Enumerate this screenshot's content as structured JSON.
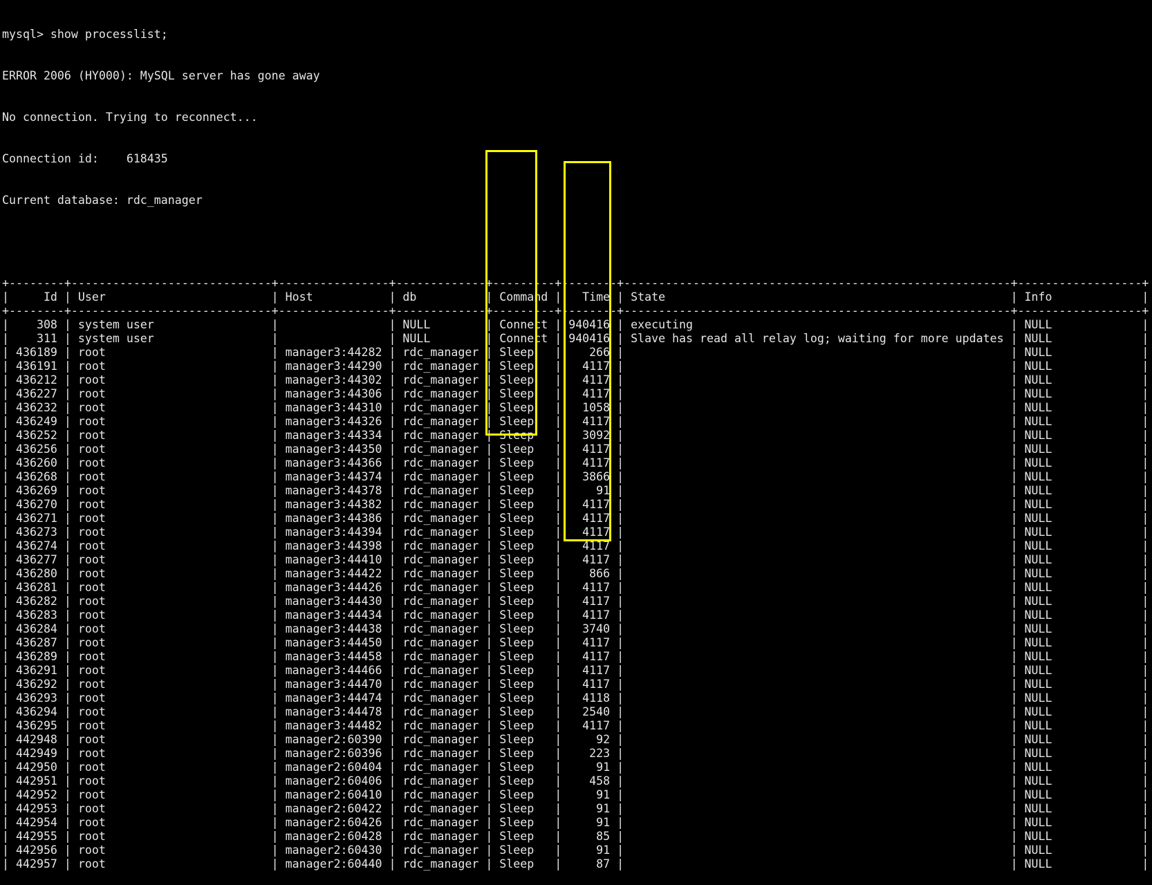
{
  "terminal": {
    "prompt_line": "mysql> show processlist;",
    "messages": [
      "ERROR 2006 (HY000): MySQL server has gone away",
      "No connection. Trying to reconnect...",
      "Connection id:    618435",
      "Current database: rdc_manager"
    ]
  },
  "table": {
    "columns": [
      "Id",
      "User",
      "Host",
      "db",
      "Command",
      "Time",
      "State",
      "Info"
    ],
    "rows": [
      [
        "308",
        "system user",
        "",
        "NULL",
        "Connect",
        "940416",
        "executing",
        "NULL"
      ],
      [
        "311",
        "system user",
        "",
        "NULL",
        "Connect",
        "940416",
        "Slave has read all relay log; waiting for more updates",
        "NULL"
      ],
      [
        "436189",
        "root",
        "manager3:44282",
        "rdc_manager",
        "Sleep",
        "266",
        "",
        "NULL"
      ],
      [
        "436191",
        "root",
        "manager3:44290",
        "rdc_manager",
        "Sleep",
        "4117",
        "",
        "NULL"
      ],
      [
        "436212",
        "root",
        "manager3:44302",
        "rdc_manager",
        "Sleep",
        "4117",
        "",
        "NULL"
      ],
      [
        "436227",
        "root",
        "manager3:44306",
        "rdc_manager",
        "Sleep",
        "4117",
        "",
        "NULL"
      ],
      [
        "436232",
        "root",
        "manager3:44310",
        "rdc_manager",
        "Sleep",
        "1058",
        "",
        "NULL"
      ],
      [
        "436249",
        "root",
        "manager3:44326",
        "rdc_manager",
        "Sleep",
        "4117",
        "",
        "NULL"
      ],
      [
        "436252",
        "root",
        "manager3:44334",
        "rdc_manager",
        "Sleep",
        "3092",
        "",
        "NULL"
      ],
      [
        "436256",
        "root",
        "manager3:44350",
        "rdc_manager",
        "Sleep",
        "4117",
        "",
        "NULL"
      ],
      [
        "436260",
        "root",
        "manager3:44366",
        "rdc_manager",
        "Sleep",
        "4117",
        "",
        "NULL"
      ],
      [
        "436268",
        "root",
        "manager3:44374",
        "rdc_manager",
        "Sleep",
        "3866",
        "",
        "NULL"
      ],
      [
        "436269",
        "root",
        "manager3:44378",
        "rdc_manager",
        "Sleep",
        "91",
        "",
        "NULL"
      ],
      [
        "436270",
        "root",
        "manager3:44382",
        "rdc_manager",
        "Sleep",
        "4117",
        "",
        "NULL"
      ],
      [
        "436271",
        "root",
        "manager3:44386",
        "rdc_manager",
        "Sleep",
        "4117",
        "",
        "NULL"
      ],
      [
        "436273",
        "root",
        "manager3:44394",
        "rdc_manager",
        "Sleep",
        "4117",
        "",
        "NULL"
      ],
      [
        "436274",
        "root",
        "manager3:44398",
        "rdc_manager",
        "Sleep",
        "4117",
        "",
        "NULL"
      ],
      [
        "436277",
        "root",
        "manager3:44410",
        "rdc_manager",
        "Sleep",
        "4117",
        "",
        "NULL"
      ],
      [
        "436280",
        "root",
        "manager3:44422",
        "rdc_manager",
        "Sleep",
        "866",
        "",
        "NULL"
      ],
      [
        "436281",
        "root",
        "manager3:44426",
        "rdc_manager",
        "Sleep",
        "4117",
        "",
        "NULL"
      ],
      [
        "436282",
        "root",
        "manager3:44430",
        "rdc_manager",
        "Sleep",
        "4117",
        "",
        "NULL"
      ],
      [
        "436283",
        "root",
        "manager3:44434",
        "rdc_manager",
        "Sleep",
        "4117",
        "",
        "NULL"
      ],
      [
        "436284",
        "root",
        "manager3:44438",
        "rdc_manager",
        "Sleep",
        "3740",
        "",
        "NULL"
      ],
      [
        "436287",
        "root",
        "manager3:44450",
        "rdc_manager",
        "Sleep",
        "4117",
        "",
        "NULL"
      ],
      [
        "436289",
        "root",
        "manager3:44458",
        "rdc_manager",
        "Sleep",
        "4117",
        "",
        "NULL"
      ],
      [
        "436291",
        "root",
        "manager3:44466",
        "rdc_manager",
        "Sleep",
        "4117",
        "",
        "NULL"
      ],
      [
        "436292",
        "root",
        "manager3:44470",
        "rdc_manager",
        "Sleep",
        "4117",
        "",
        "NULL"
      ],
      [
        "436293",
        "root",
        "manager3:44474",
        "rdc_manager",
        "Sleep",
        "4118",
        "",
        "NULL"
      ],
      [
        "436294",
        "root",
        "manager3:44478",
        "rdc_manager",
        "Sleep",
        "2540",
        "",
        "NULL"
      ],
      [
        "436295",
        "root",
        "manager3:44482",
        "rdc_manager",
        "Sleep",
        "4117",
        "",
        "NULL"
      ],
      [
        "442948",
        "root",
        "manager2:60390",
        "rdc_manager",
        "Sleep",
        "92",
        "",
        "NULL"
      ],
      [
        "442949",
        "root",
        "manager2:60396",
        "rdc_manager",
        "Sleep",
        "223",
        "",
        "NULL"
      ],
      [
        "442950",
        "root",
        "manager2:60404",
        "rdc_manager",
        "Sleep",
        "91",
        "",
        "NULL"
      ],
      [
        "442951",
        "root",
        "manager2:60406",
        "rdc_manager",
        "Sleep",
        "458",
        "",
        "NULL"
      ],
      [
        "442952",
        "root",
        "manager2:60410",
        "rdc_manager",
        "Sleep",
        "91",
        "",
        "NULL"
      ],
      [
        "442953",
        "root",
        "manager2:60422",
        "rdc_manager",
        "Sleep",
        "91",
        "",
        "NULL"
      ],
      [
        "442954",
        "root",
        "manager2:60426",
        "rdc_manager",
        "Sleep",
        "91",
        "",
        "NULL"
      ],
      [
        "442955",
        "root",
        "manager2:60428",
        "rdc_manager",
        "Sleep",
        "85",
        "",
        "NULL"
      ],
      [
        "442956",
        "root",
        "manager2:60430",
        "rdc_manager",
        "Sleep",
        "91",
        "",
        "NULL"
      ],
      [
        "442957",
        "root",
        "manager2:60440",
        "rdc_manager",
        "Sleep",
        "87",
        "",
        "NULL"
      ]
    ]
  },
  "annotations": {
    "highlight_color": "#ffff00",
    "command_highlight": "Command column Sleep rows 436189–436283",
    "time_highlight": "Time column rows 436191–436295"
  }
}
